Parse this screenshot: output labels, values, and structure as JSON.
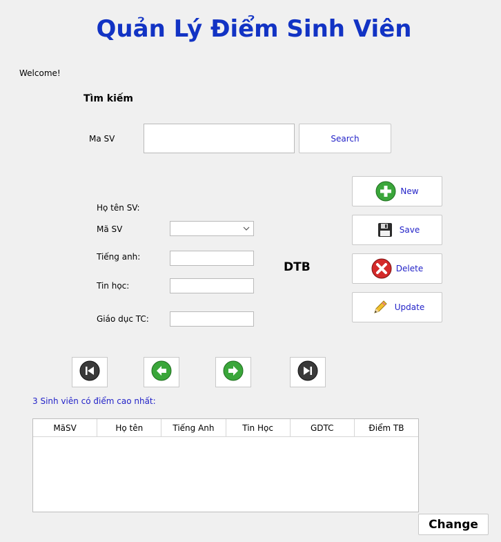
{
  "title": "Quản Lý Điểm Sinh Viên",
  "welcome": "Welcome!",
  "search": {
    "heading": "Tìm kiếm",
    "label": "Ma SV",
    "value": "",
    "button": "Search"
  },
  "form": {
    "name_label": "Họ tên SV:",
    "id_label": "Mã SV",
    "id_value": "",
    "english_label": "Tiếng anh:",
    "english_value": "",
    "it_label": "Tin học:",
    "it_value": "",
    "pe_label": "Giáo dục TC:",
    "pe_value": "",
    "dtb_label": "DTB"
  },
  "actions": {
    "new": "New",
    "save": "Save",
    "delete": "Delete",
    "update": "Update"
  },
  "icons": {
    "new": "plus-circle-icon",
    "save": "floppy-disk-icon",
    "delete": "close-circle-icon",
    "update": "pencil-icon",
    "first": "first-record-icon",
    "prev": "arrow-left-icon",
    "next": "arrow-right-icon",
    "last": "last-record-icon"
  },
  "top_students": {
    "caption": "3 Sinh viên có điểm cao nhất:",
    "columns": [
      "MãSV",
      "Họ tên",
      "Tiếng Anh",
      "Tin Học",
      "GDTC",
      "Điểm TB"
    ],
    "rows": []
  },
  "change_button": "Change"
}
